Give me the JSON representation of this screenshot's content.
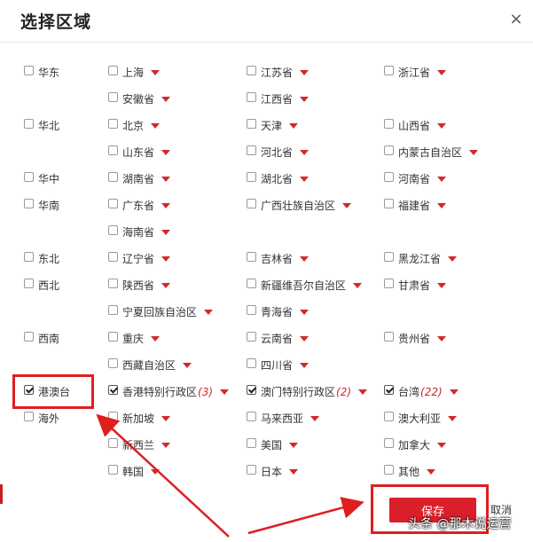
{
  "dialog": {
    "title": "选择区域",
    "close_symbol": "×",
    "save_label": "保存",
    "cancel_label": "取消",
    "watermark": "头条 @那木说运营"
  },
  "regions": [
    {
      "name": "华东",
      "provinces": [
        [
          "上海",
          false,
          ""
        ],
        [
          "江苏省",
          false,
          ""
        ],
        [
          "浙江省",
          false,
          ""
        ],
        [
          "安徽省",
          false,
          ""
        ],
        [
          "江西省",
          false,
          ""
        ]
      ]
    },
    {
      "name": "华北",
      "provinces": [
        [
          "北京",
          false,
          ""
        ],
        [
          "天津",
          false,
          ""
        ],
        [
          "山西省",
          false,
          ""
        ],
        [
          "山东省",
          false,
          ""
        ],
        [
          "河北省",
          false,
          ""
        ],
        [
          "内蒙古自治区",
          false,
          ""
        ]
      ]
    },
    {
      "name": "华中",
      "provinces": [
        [
          "湖南省",
          false,
          ""
        ],
        [
          "湖北省",
          false,
          ""
        ],
        [
          "河南省",
          false,
          ""
        ]
      ]
    },
    {
      "name": "华南",
      "provinces": [
        [
          "广东省",
          false,
          ""
        ],
        [
          "广西壮族自治区",
          false,
          ""
        ],
        [
          "福建省",
          false,
          ""
        ],
        [
          "海南省",
          false,
          ""
        ]
      ]
    },
    {
      "name": "东北",
      "provinces": [
        [
          "辽宁省",
          false,
          ""
        ],
        [
          "吉林省",
          false,
          ""
        ],
        [
          "黑龙江省",
          false,
          ""
        ]
      ]
    },
    {
      "name": "西北",
      "provinces": [
        [
          "陕西省",
          false,
          ""
        ],
        [
          "新疆维吾尔自治区",
          false,
          ""
        ],
        [
          "甘肃省",
          false,
          ""
        ],
        [
          "宁夏回族自治区",
          false,
          ""
        ],
        [
          "青海省",
          false,
          ""
        ]
      ]
    },
    {
      "name": "西南",
      "provinces": [
        [
          "重庆",
          false,
          ""
        ],
        [
          "云南省",
          false,
          ""
        ],
        [
          "贵州省",
          false,
          ""
        ],
        [
          "西藏自治区",
          false,
          ""
        ],
        [
          "四川省",
          false,
          ""
        ]
      ]
    },
    {
      "name": "港澳台",
      "checked": true,
      "provinces": [
        [
          "香港特别行政区",
          true,
          "(3)"
        ],
        [
          "澳门特别行政区",
          true,
          "(2)"
        ],
        [
          "台湾",
          true,
          "(22)"
        ]
      ]
    },
    {
      "name": "海外",
      "provinces": [
        [
          "新加坡",
          false,
          ""
        ],
        [
          "马来西亚",
          false,
          ""
        ],
        [
          "澳大利亚",
          false,
          ""
        ],
        [
          "新西兰",
          false,
          ""
        ],
        [
          "美国",
          false,
          ""
        ],
        [
          "加拿大",
          false,
          ""
        ],
        [
          "韩国",
          false,
          ""
        ],
        [
          "日本",
          false,
          ""
        ],
        [
          "其他",
          false,
          ""
        ]
      ]
    }
  ],
  "colors": {
    "accent": "#d91f2a",
    "highlight": "#e01e1e"
  }
}
